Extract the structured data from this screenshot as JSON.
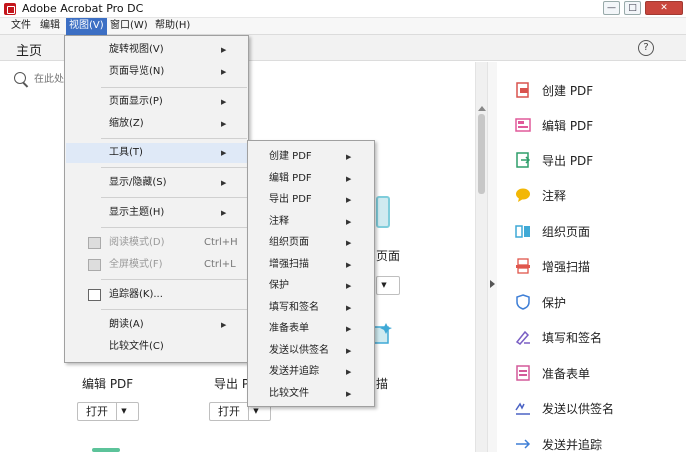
{
  "window": {
    "title": "Adobe Acrobat Pro DC",
    "minimize": "—",
    "maximize": "□",
    "close": "✕"
  },
  "menubar": {
    "items": [
      "文件",
      "编辑",
      "视图(V)",
      "窗口(W)",
      "帮助(H)"
    ]
  },
  "tabs": {
    "home": "主页"
  },
  "search": {
    "placeholder": "在此处"
  },
  "main": {
    "cards": [
      {
        "label": "编辑 PDF",
        "open": "打开"
      },
      {
        "label": "导出 P",
        "open": "打开"
      }
    ],
    "partial_labels": {
      "page": "页面",
      "scan": "描"
    }
  },
  "view_menu": {
    "items": [
      {
        "label": "旋转视图(V)",
        "submenu": true
      },
      {
        "label": "页面导览(N)",
        "submenu": true
      },
      {
        "label": "页面显示(P)",
        "submenu": true
      },
      {
        "label": "缩放(Z)",
        "submenu": true
      },
      {
        "label": "工具(T)",
        "submenu": true
      },
      {
        "label": "显示/隐藏(S)",
        "submenu": true
      },
      {
        "label": "显示主题(H)",
        "submenu": true
      },
      {
        "label": "阅读模式(D)",
        "shortcut": "Ctrl+H",
        "disabled": true
      },
      {
        "label": "全屏模式(F)",
        "shortcut": "Ctrl+L",
        "disabled": true
      },
      {
        "label": "追踪器(K)...",
        "submenu": false
      },
      {
        "label": "朗读(A)",
        "submenu": true
      },
      {
        "label": "比较文件(C)",
        "submenu": false
      }
    ]
  },
  "tools_menu": {
    "items": [
      "创建 PDF",
      "编辑 PDF",
      "导出 PDF",
      "注释",
      "组织页面",
      "增强扫描",
      "保护",
      "填写和签名",
      "准备表单",
      "发送以供签名",
      "发送并追踪",
      "比较文件"
    ]
  },
  "right_panel": {
    "items": [
      {
        "label": "创建 PDF",
        "icon": "create-pdf-icon",
        "color": "#d9534f"
      },
      {
        "label": "编辑 PDF",
        "icon": "edit-pdf-icon",
        "color": "#e05a9a"
      },
      {
        "label": "导出 PDF",
        "icon": "export-pdf-icon",
        "color": "#2e9e6a"
      },
      {
        "label": "注释",
        "icon": "comment-icon",
        "color": "#f2b705"
      },
      {
        "label": "组织页面",
        "icon": "organize-pages-icon",
        "color": "#3fa9d6"
      },
      {
        "label": "增强扫描",
        "icon": "enhance-scan-icon",
        "color": "#e0564c"
      },
      {
        "label": "保护",
        "icon": "protect-icon",
        "color": "#3f7fd6"
      },
      {
        "label": "填写和签名",
        "icon": "fill-sign-icon",
        "color": "#7a5fc4"
      },
      {
        "label": "准备表单",
        "icon": "prepare-form-icon",
        "color": "#d45a9a"
      },
      {
        "label": "发送以供签名",
        "icon": "send-for-signature-icon",
        "color": "#4a62c4"
      },
      {
        "label": "发送并追踪",
        "icon": "send-track-icon",
        "color": "#3f7fd6"
      }
    ]
  },
  "help": {
    "symbol": "?"
  }
}
